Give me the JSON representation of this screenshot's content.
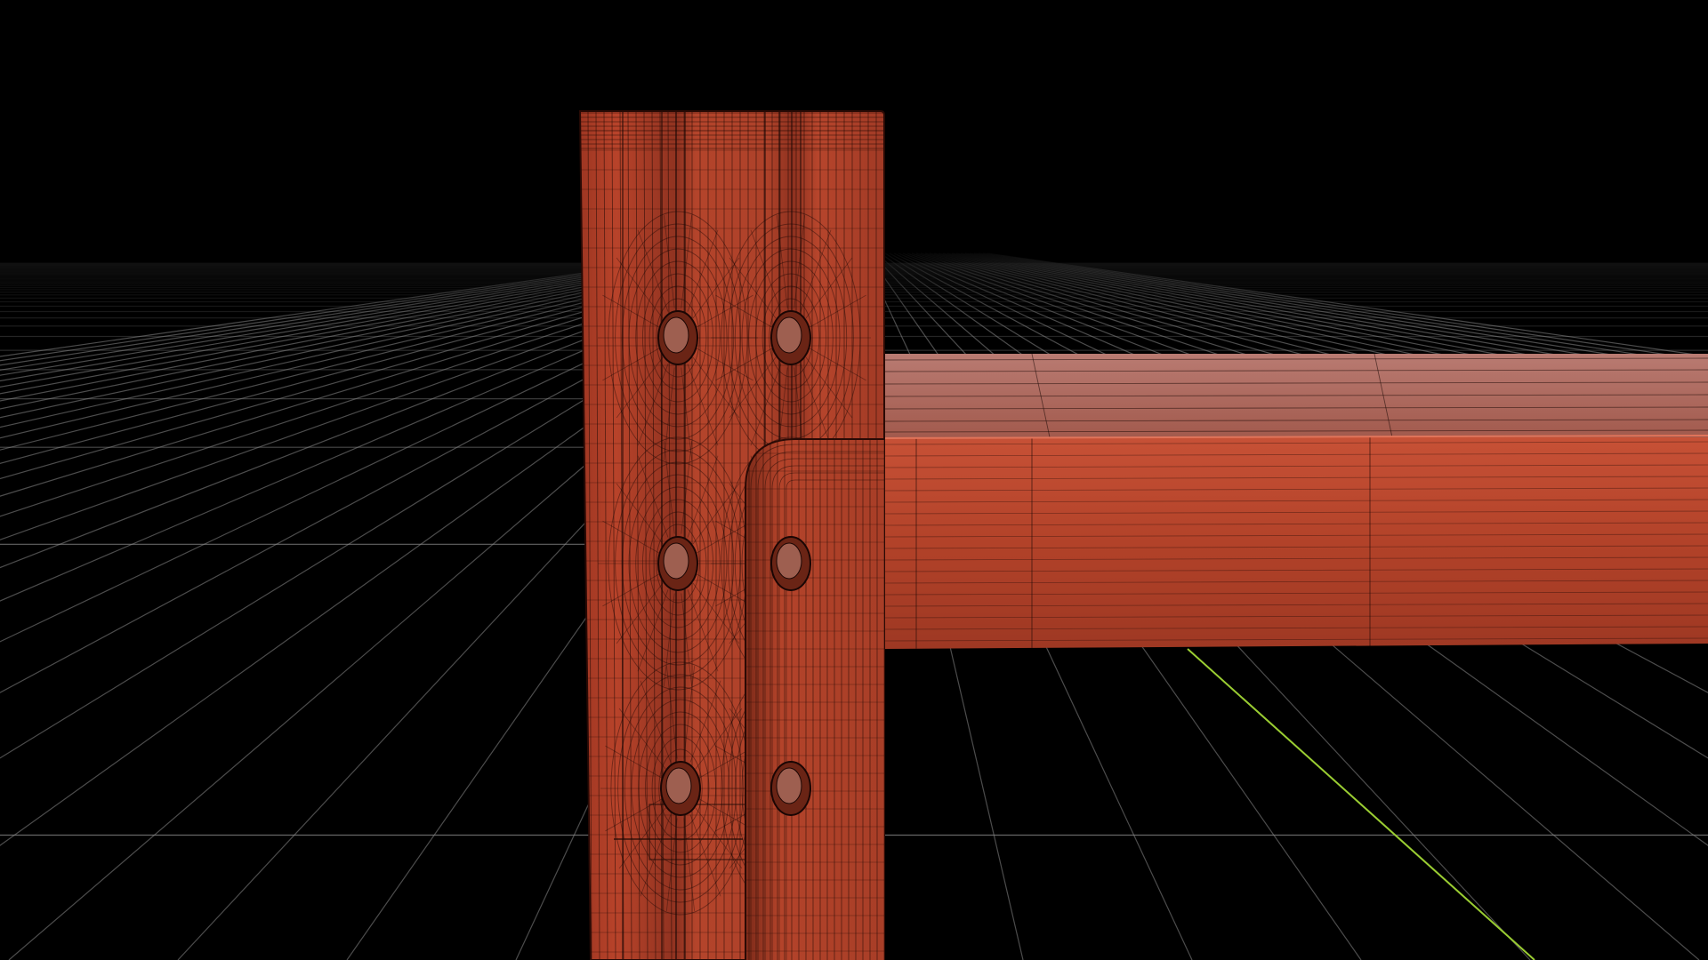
{
  "viewport": {
    "background_color": "#000000",
    "grid_color": "#8a8a8a",
    "axis_color": "#9acd32",
    "material_color": "#b8432a",
    "material_highlight": "#c95a3c",
    "material_shadow": "#8a2f1c",
    "top_face_color": "#b06a5f",
    "wire_color": "#1a0704",
    "grid_visible": true,
    "wireframe_overlay": true
  },
  "scene": {
    "objects": [
      {
        "name": "vertical-bracket-plate",
        "holes": 6
      },
      {
        "name": "horizontal-beam"
      },
      {
        "name": "bent-flange"
      }
    ]
  }
}
